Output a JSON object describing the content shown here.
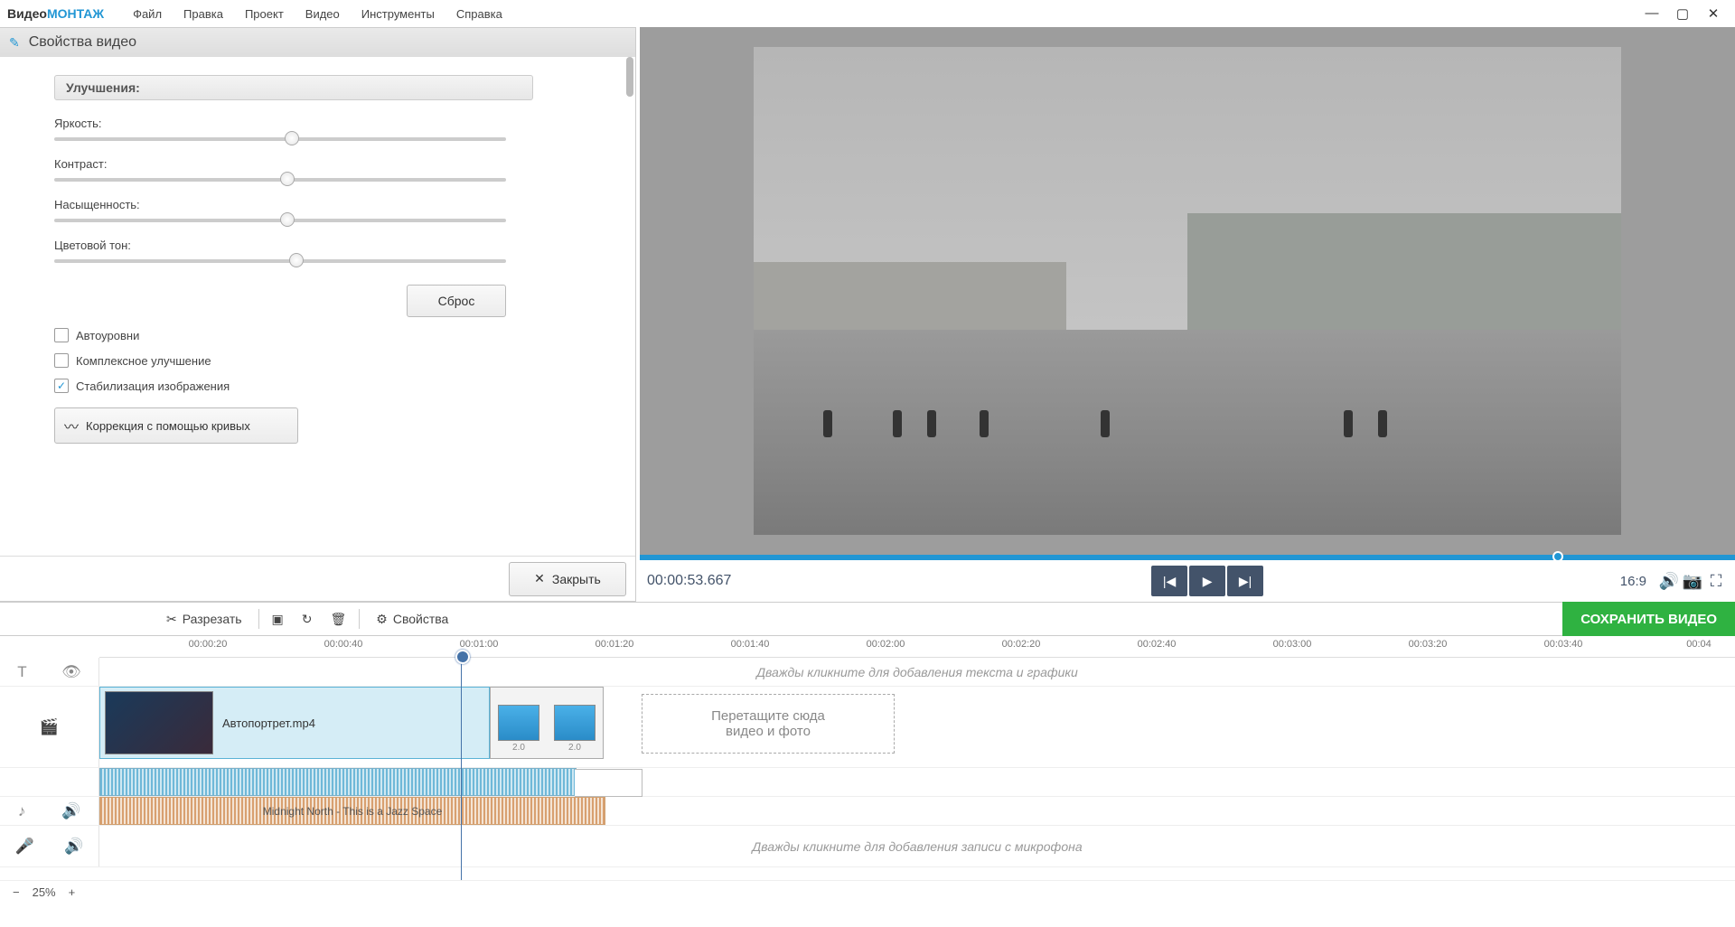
{
  "app": {
    "brand1": "Видео",
    "brand2": "МОНТАЖ"
  },
  "menu": [
    "Файл",
    "Правка",
    "Проект",
    "Видео",
    "Инструменты",
    "Справка"
  ],
  "props": {
    "title": "Свойства видео",
    "section": "Улучшения:",
    "sliders": {
      "brightness": {
        "label": "Яркость:",
        "pos": 51
      },
      "contrast": {
        "label": "Контраст:",
        "pos": 50
      },
      "saturation": {
        "label": "Насыщенность:",
        "pos": 50
      },
      "hue": {
        "label": "Цветовой тон:",
        "pos": 52
      }
    },
    "reset": "Сброс",
    "cb_auto": {
      "label": "Автоуровни",
      "checked": false
    },
    "cb_complex": {
      "label": "Комплексное улучшение",
      "checked": false
    },
    "cb_stab": {
      "label": "Стабилизация изображения",
      "checked": true
    },
    "curves": "Коррекция с помощью кривых",
    "close": "Закрыть"
  },
  "preview": {
    "timecode": "00:00:53.667",
    "aspect": "16:9"
  },
  "toolbar": {
    "cut": "Разрезать",
    "properties": "Свойства",
    "save": "СОХРАНИТЬ ВИДЕО"
  },
  "ruler": [
    "00:00:20",
    "00:00:40",
    "00:01:00",
    "00:01:20",
    "00:01:40",
    "00:02:00",
    "00:02:20",
    "00:02:40",
    "00:03:00",
    "00:03:20",
    "00:03:40",
    "00:04"
  ],
  "tracks": {
    "text_placeholder": "Дважды кликните для добавления текста и графики",
    "mic_placeholder": "Дважды кликните для добавления записи с микрофона",
    "clip1_name": "Автопортрет.mp4",
    "dropzone_l1": "Перетащите сюда",
    "dropzone_l2": "видео и фото",
    "music_name": "Midnight North - This is a Jazz Space"
  },
  "zoom": "25%"
}
